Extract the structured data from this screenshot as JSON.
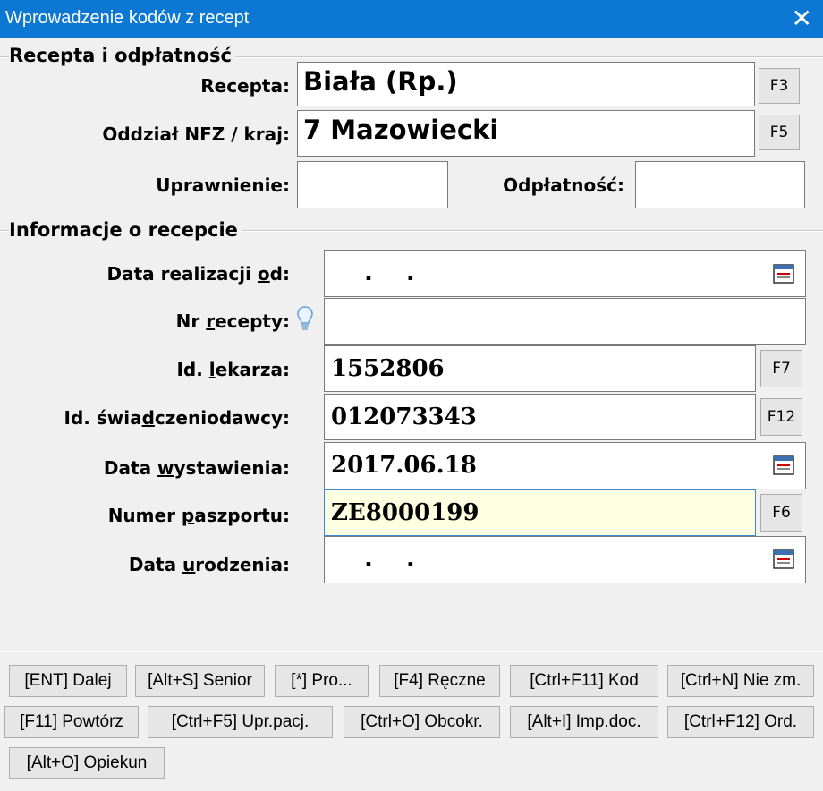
{
  "window": {
    "title": "Wprowadzenie kodów z recept",
    "close_glyph": "✕"
  },
  "sections": {
    "recepta": "Recepta i odpłatność",
    "informacje": "Informacje o recepcie"
  },
  "fields": {
    "recepta": {
      "label": "Recepta:",
      "value": "Biała (Rp.)",
      "key": "F3"
    },
    "oddzial": {
      "label": "Oddział NFZ / kraj:",
      "value": "7 Mazowiecki",
      "key": "F5"
    },
    "uprawnienie": {
      "label": "Uprawnienie:",
      "value": ""
    },
    "odplatnosc": {
      "label": "Odpłatność:",
      "value": ""
    },
    "data_realizacji": {
      "label_pre": "Data realizacji ",
      "label_u": "o",
      "label_post": "d:",
      "value": ". ."
    },
    "nr_recepty": {
      "label_pre": "Nr ",
      "label_u": "r",
      "label_post": "ecepty:",
      "value": ""
    },
    "id_lekarza": {
      "label_pre": "Id. ",
      "label_u": "l",
      "label_post": "ekarza:",
      "value": "1552806",
      "key": "F7"
    },
    "id_swiadczeniodawcy": {
      "label_pre": "Id. świa",
      "label_u": "d",
      "label_post": "czeniodawcy:",
      "value": "012073343",
      "key": "F12"
    },
    "data_wystawienia": {
      "label_pre": "Data ",
      "label_u": "w",
      "label_post": "ystawienia:",
      "value": "2017.06.18"
    },
    "numer_paszportu": {
      "label_pre": "Numer ",
      "label_u": "p",
      "label_post": "aszportu:",
      "value": "ZE8000199",
      "key": "F6"
    },
    "data_urodzenia": {
      "label_pre": "Data ",
      "label_u": "u",
      "label_post": "rodzenia:",
      "value": ". ."
    }
  },
  "buttons": [
    "[ENT] Dalej",
    "[Alt+S] Senior",
    "[*] Pro...",
    "[F4] Ręczne",
    "[Ctrl+F11] Kod",
    "[Ctrl+N] Nie zm.",
    "[F11] Powtórz",
    "[Ctrl+F5] Upr.pacj.",
    "[Ctrl+O] Obcokr.",
    "[Alt+I] Imp.doc.",
    "[Ctrl+F12] Ord.",
    "[Alt+O] Opiekun"
  ],
  "icons": {
    "calendar": "calendar-icon",
    "hint": "lightbulb-icon",
    "close": "close-icon"
  },
  "colors": {
    "titlebar": "#0d78d3",
    "highlight_field": "#ffffe1"
  }
}
